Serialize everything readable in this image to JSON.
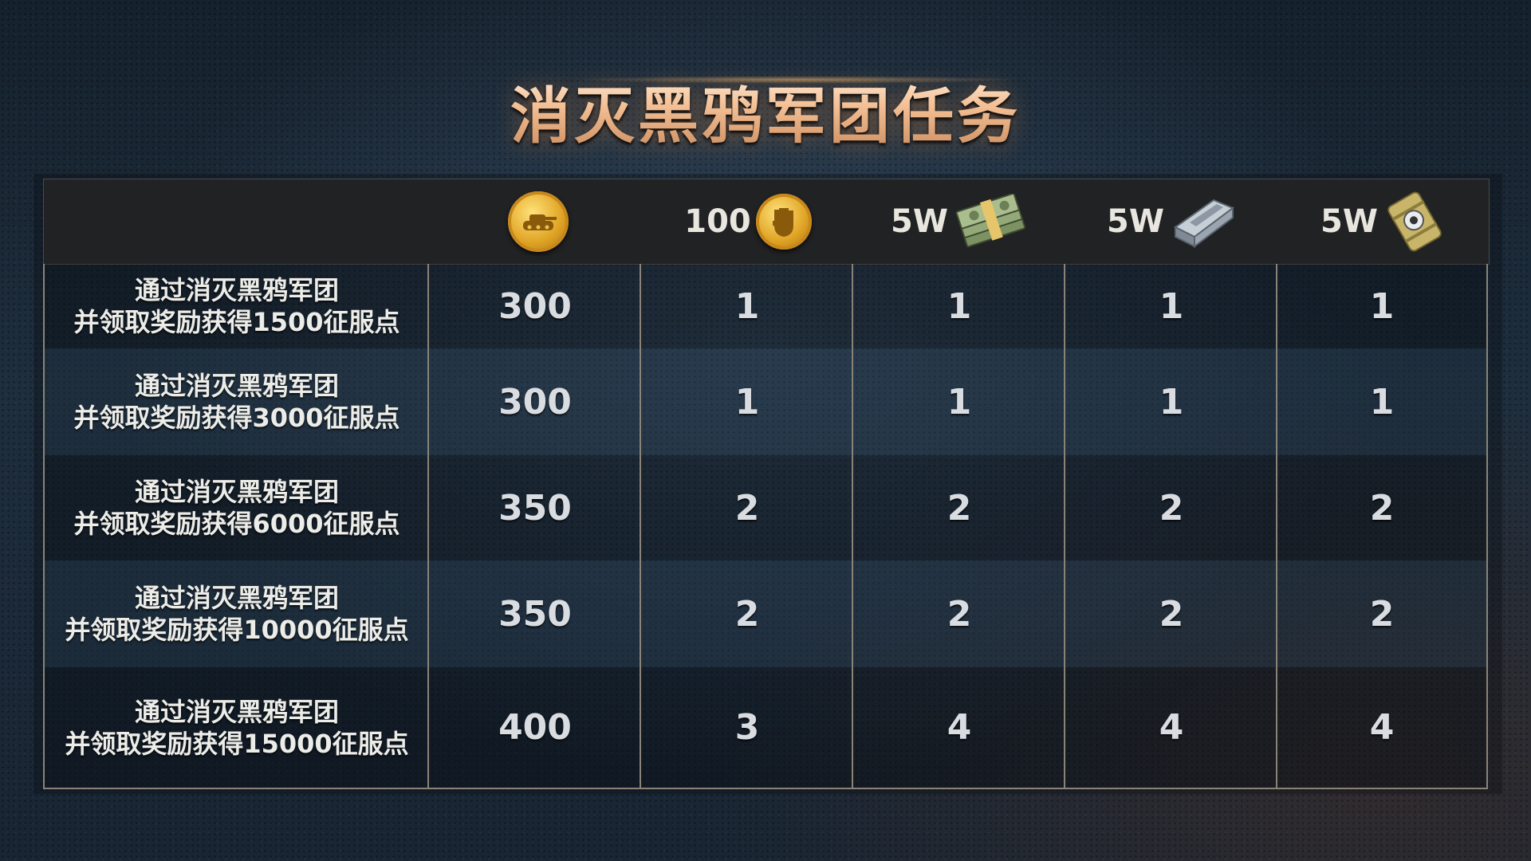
{
  "title": "消灭黑鸦军团任务",
  "header": {
    "columns": [
      {
        "icon": "tank-gold-coin-icon",
        "prefix": ""
      },
      {
        "icon": "fist-gold-coin-icon",
        "prefix": "100"
      },
      {
        "icon": "cash-stack-icon",
        "prefix": "5W"
      },
      {
        "icon": "metal-ingot-icon",
        "prefix": "5W"
      },
      {
        "icon": "fuel-barrel-icon",
        "prefix": "5W"
      }
    ]
  },
  "rows": [
    {
      "task_line1": "通过消灭黑鸦军团",
      "task_line2": "并领取奖励获得1500征服点",
      "values": [
        "300",
        "1",
        "1",
        "1",
        "1"
      ]
    },
    {
      "task_line1": "通过消灭黑鸦军团",
      "task_line2": "并领取奖励获得3000征服点",
      "values": [
        "300",
        "1",
        "1",
        "1",
        "1"
      ]
    },
    {
      "task_line1": "通过消灭黑鸦军团",
      "task_line2": "并领取奖励获得6000征服点",
      "values": [
        "350",
        "2",
        "2",
        "2",
        "2"
      ]
    },
    {
      "task_line1": "通过消灭黑鸦军团",
      "task_line2": "并领取奖励获得10000征服点",
      "values": [
        "350",
        "2",
        "2",
        "2",
        "2"
      ]
    },
    {
      "task_line1": "通过消灭黑鸦军团",
      "task_line2": "并领取奖励获得15000征服点",
      "values": [
        "400",
        "3",
        "4",
        "4",
        "4"
      ]
    }
  ],
  "colors": {
    "title_gold": "#f3bf94",
    "grid_line": "#8a8478",
    "header_bg": "#202224",
    "text": "#d9dde2"
  }
}
